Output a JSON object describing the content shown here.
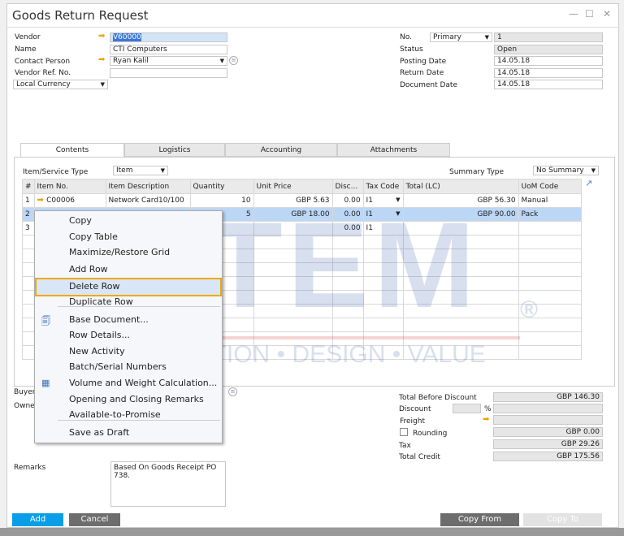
{
  "window": {
    "title": "Goods Return Request",
    "minimize": "—",
    "maximize": "☐",
    "close": "✕"
  },
  "header_left": {
    "vendor_label": "Vendor",
    "vendor_value": "V60000",
    "name_label": "Name",
    "name_value": "CTI Computers",
    "contact_label": "Contact Person",
    "contact_value": "Ryan Kalil",
    "ref_label": "Vendor Ref. No.",
    "ref_value": "",
    "currency_value": "Local Currency"
  },
  "header_right": {
    "no_label": "No.",
    "series_value": "Primary",
    "no_value": "1",
    "status_label": "Status",
    "status_value": "Open",
    "posting_label": "Posting Date",
    "posting_value": "14.05.18",
    "return_label": "Return Date",
    "return_value": "14.05.18",
    "document_label": "Document Date",
    "document_value": "14.05.18"
  },
  "tabs": [
    "Contents",
    "Logistics",
    "Accounting",
    "Attachments"
  ],
  "contents": {
    "item_type_label": "Item/Service Type",
    "item_type_value": "Item",
    "summary_label": "Summary Type",
    "summary_value": "No Summary"
  },
  "grid": {
    "columns": [
      "#",
      "Item No.",
      "Item Description",
      "Quantity",
      "Unit Price",
      "Disc...",
      "Tax Code",
      "Total (LC)",
      "UoM Code"
    ],
    "rows": [
      {
        "n": "1",
        "item": "C00006",
        "desc": "Network Card10/100",
        "qty": "10",
        "price": "GBP 5.63",
        "disc": "0.00",
        "tax": "I1",
        "total": "GBP 56.30",
        "uom": "Manual"
      },
      {
        "n": "2",
        "item": "",
        "desc": "",
        "qty": "5",
        "price": "GBP 18.00",
        "disc": "0.00",
        "tax": "I1",
        "total": "GBP 90.00",
        "uom": "Pack"
      },
      {
        "n": "3",
        "item": "",
        "desc": "",
        "qty": "",
        "price": "",
        "disc": "0.00",
        "tax": "I1",
        "total": "",
        "uom": ""
      }
    ]
  },
  "context_menu": [
    "Copy",
    "Copy Table",
    "Maximize/Restore Grid",
    "Add Row",
    "Delete Row",
    "Duplicate Row",
    "Base Document...",
    "Row Details...",
    "New Activity",
    "Batch/Serial Numbers",
    "Volume and Weight Calculation...",
    "Opening and Closing Remarks",
    "Available-to-Promise",
    "Save as Draft"
  ],
  "footer_left": {
    "buyer_label": "Buyer",
    "owner_label": "Owne",
    "remarks_label": "Remarks",
    "remarks_value": "Based On Goods Receipt PO 738."
  },
  "totals": {
    "before_discount_label": "Total Before Discount",
    "before_discount_value": "GBP 146.30",
    "discount_label": "Discount",
    "discount_pct": "%",
    "freight_label": "Freight",
    "rounding_label": "Rounding",
    "rounding_value": "GBP 0.00",
    "tax_label": "Tax",
    "tax_value": "GBP 29.26",
    "total_label": "Total Credit",
    "total_value": "GBP 175.56"
  },
  "buttons": {
    "add": "Add",
    "cancel": "Cancel",
    "copy_from": "Copy From",
    "copy_to": "Copy To"
  },
  "watermark": {
    "brand": "STEM",
    "registered": "®",
    "tagline": "INNOVATION • DESIGN • VALUE"
  }
}
